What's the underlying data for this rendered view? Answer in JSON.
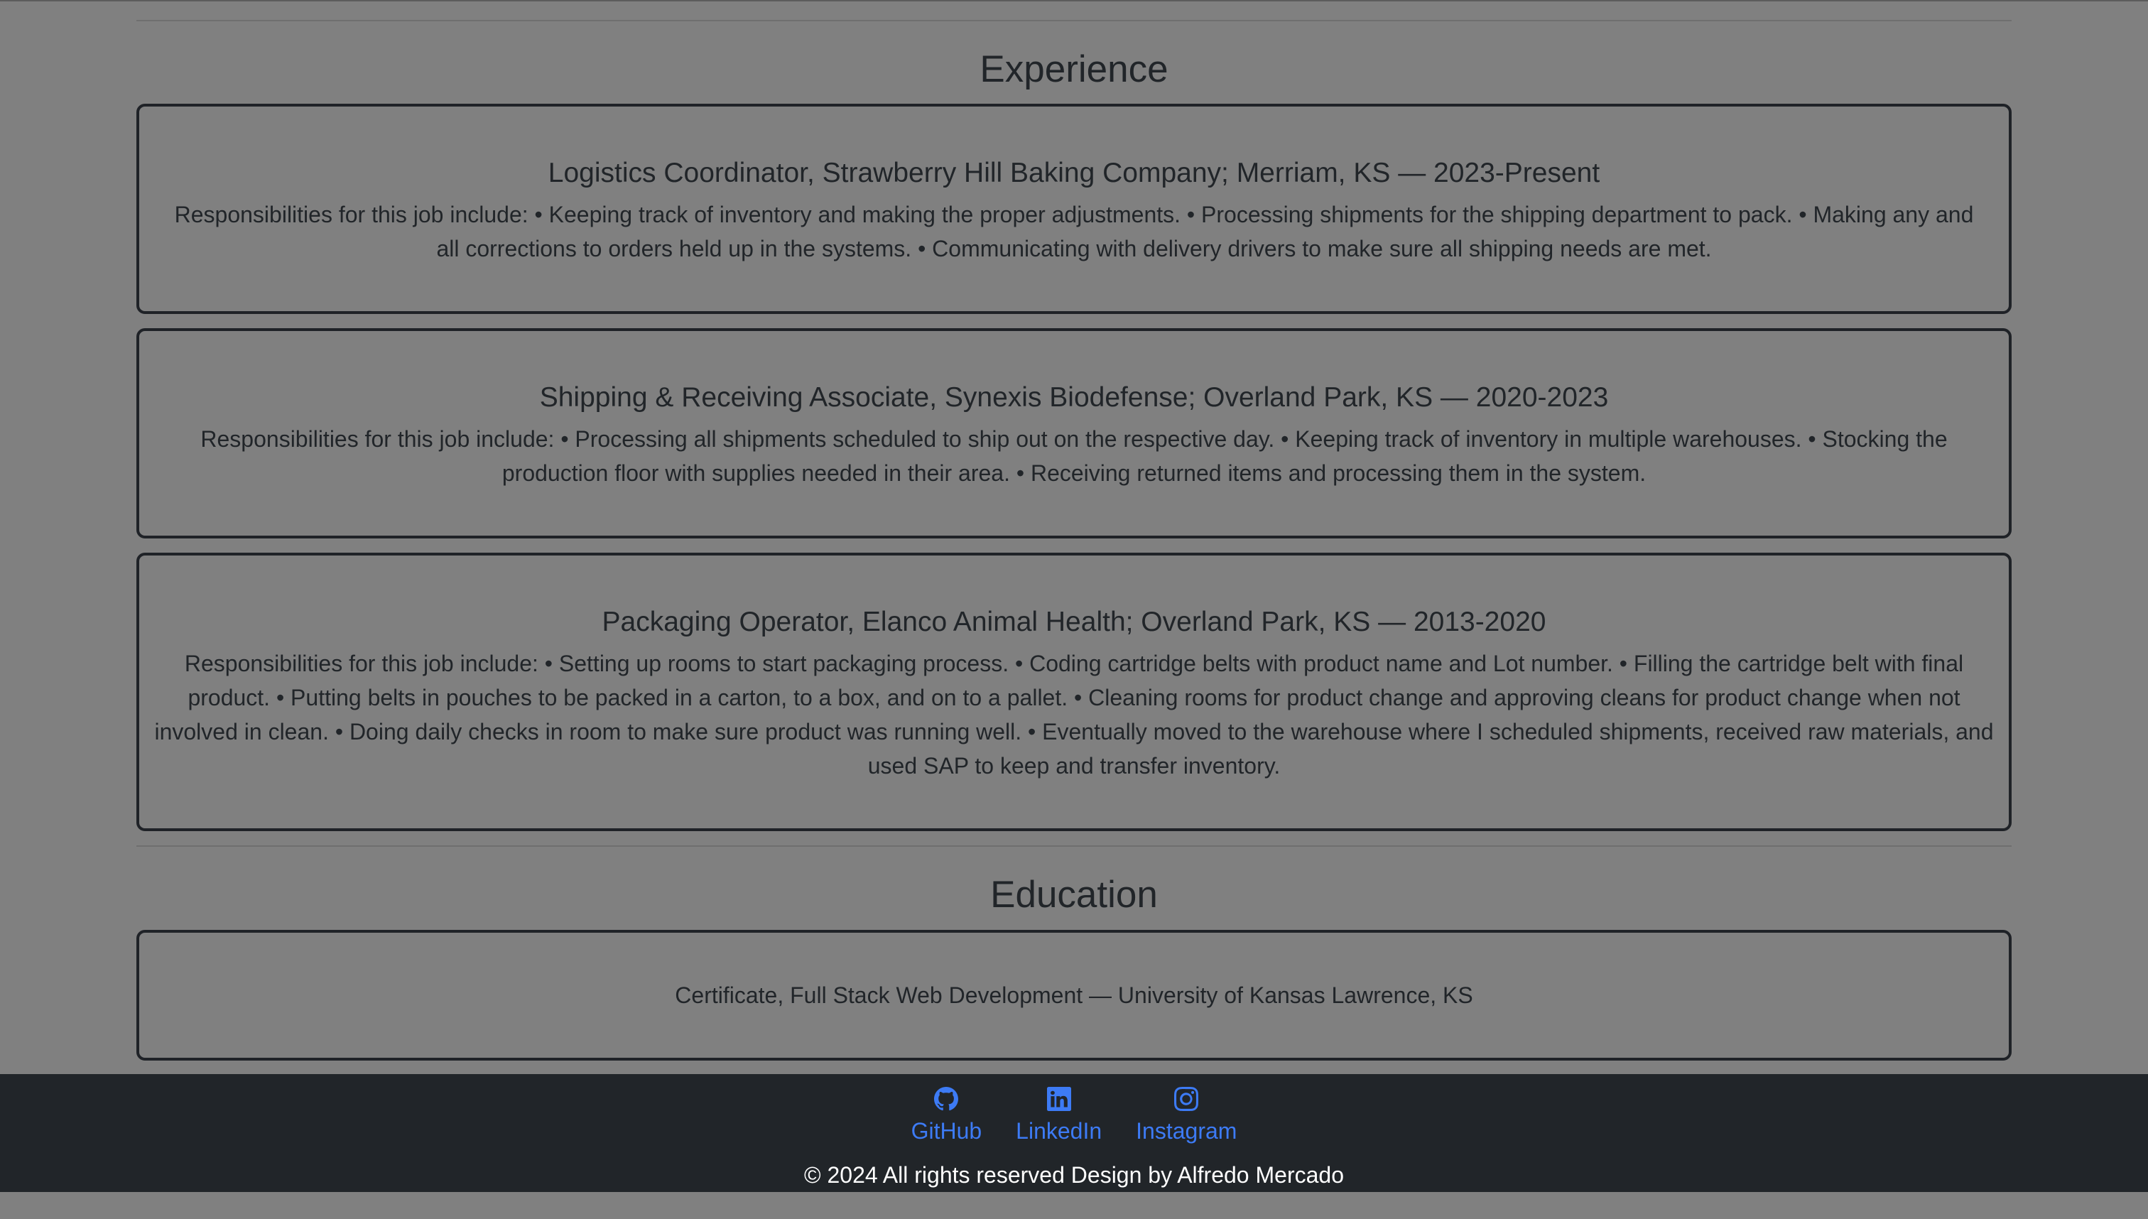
{
  "experience": {
    "title": "Experience",
    "jobs": [
      {
        "title": "Logistics Coordinator, Strawberry Hill Baking Company; Merriam, KS — 2023-Present",
        "description": "Responsibilities for this job include: • Keeping track of inventory and making the proper adjustments. • Processing shipments for the shipping department to pack. • Making any and all corrections to orders held up in the systems. • Communicating with delivery drivers to make sure all shipping needs are met."
      },
      {
        "title": "Shipping & Receiving Associate, Synexis Biodefense; Overland Park, KS — 2020-2023",
        "description": "Responsibilities for this job include: • Processing all shipments scheduled to ship out on the respective day. • Keeping track of inventory in multiple warehouses. • Stocking the production floor with supplies needed in their area. • Receiving returned items and processing them in the system."
      },
      {
        "title": "Packaging Operator, Elanco Animal Health; Overland Park, KS — 2013-2020",
        "description": "Responsibilities for this job include: • Setting up rooms to start packaging process. • Coding cartridge belts with product name and Lot number. • Filling the cartridge belt with final product. • Putting belts in pouches to be packed in a carton, to a box, and on to a pallet. • Cleaning rooms for product change and approving cleans for product change when not involved in clean. • Doing daily checks in room to make sure product was running well. • Eventually moved to the warehouse where I scheduled shipments, received raw materials, and used SAP to keep and transfer inventory."
      }
    ]
  },
  "education": {
    "title": "Education",
    "entries": [
      "Certificate, Full Stack Web Development — University of Kansas Lawrence, KS"
    ]
  },
  "footer": {
    "links": [
      {
        "label": "GitHub",
        "icon": "github-icon"
      },
      {
        "label": "LinkedIn",
        "icon": "linkedin-icon"
      },
      {
        "label": "Instagram",
        "icon": "instagram-icon"
      }
    ],
    "copyright": "© 2024 All rights reserved Design by Alfredo Mercado"
  },
  "colors": {
    "background": "#808080",
    "footer_bg": "#212529",
    "link": "#3d7bf5",
    "border": "#1f2227"
  }
}
